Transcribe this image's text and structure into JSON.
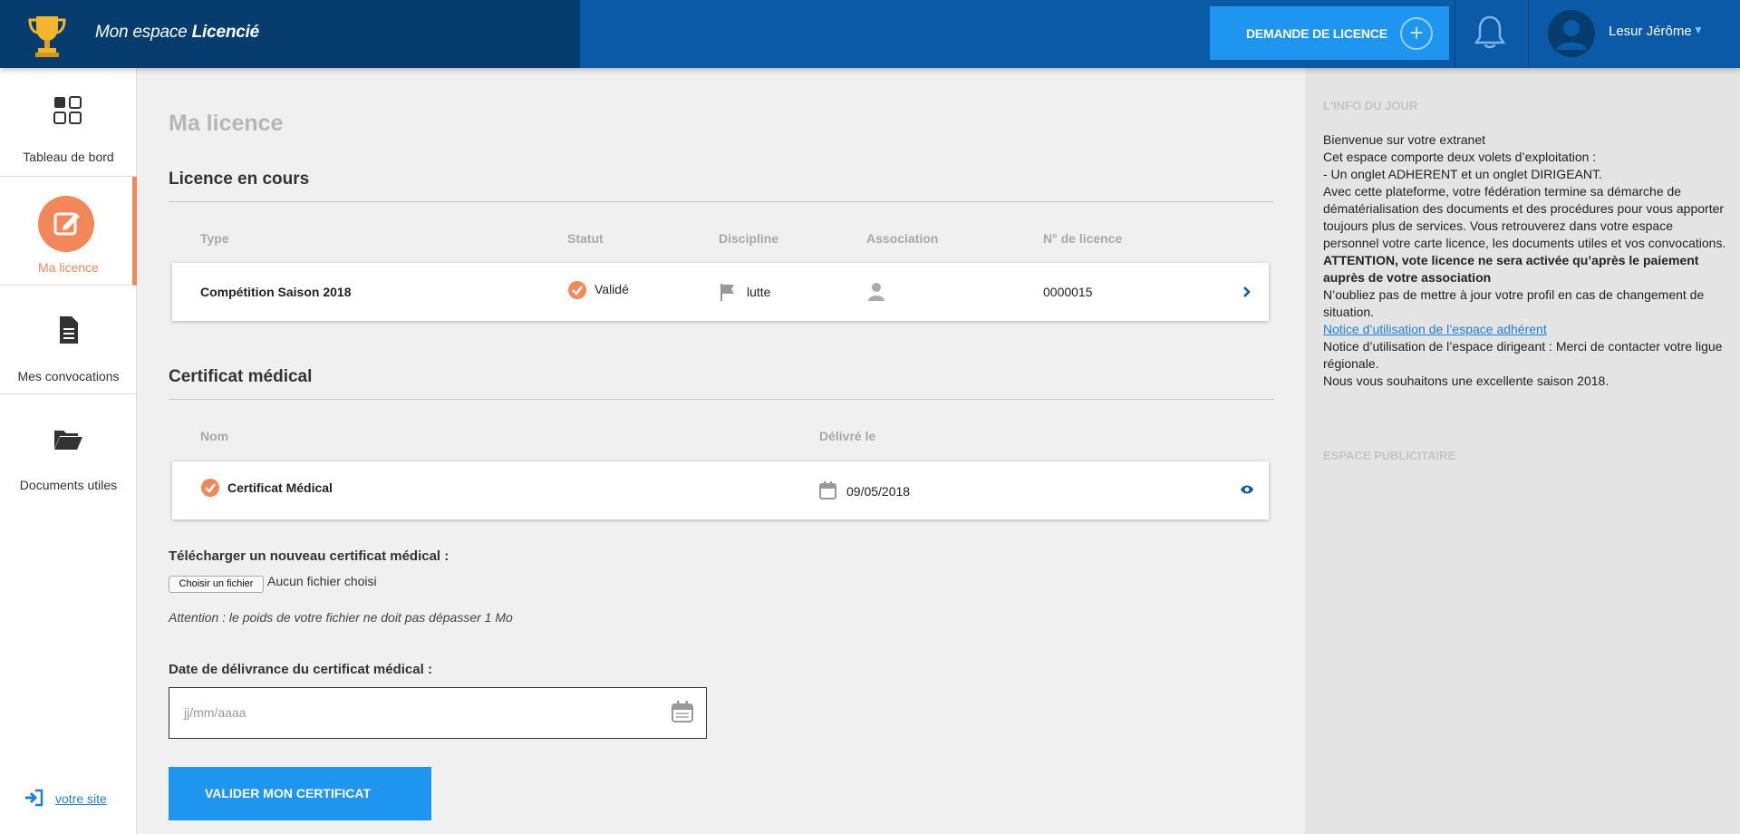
{
  "header": {
    "brand_prefix": "Mon espace",
    "brand_strong": "Licencié",
    "demande_label": "DEMANDE DE LICENCE",
    "user_name": "Lesur Jérôme",
    "colors": {
      "left": "#063c6e",
      "right": "#0b5aa8",
      "button": "#1e96f0"
    },
    "icons": {
      "logo": "trophy-icon",
      "add": "plus-circle-icon",
      "notifications": "bell-icon",
      "avatar": "user-avatar-icon",
      "menu": "chevron-down-icon"
    }
  },
  "sidebar": {
    "items": [
      {
        "label": "Tableau de bord",
        "icon": "dashboard-grid-icon",
        "active": false
      },
      {
        "label": "Ma licence",
        "icon": "edit-icon",
        "active": true
      },
      {
        "label": "Mes convocations",
        "icon": "document-icon",
        "active": false
      },
      {
        "label": "Documents utiles",
        "icon": "folder-open-icon",
        "active": false
      }
    ],
    "footer_link": "votre site",
    "accent": "#f2875a"
  },
  "main": {
    "page_title": "Ma licence",
    "licence": {
      "section_title": "Licence en cours",
      "columns": [
        "Type",
        "Statut",
        "Discipline",
        "Association",
        "N° de licence"
      ],
      "row": {
        "type": "Compétition Saison 2018",
        "statut": "Validé",
        "discipline": "lutte",
        "numero": "0000015"
      }
    },
    "certificat": {
      "section_title": "Certificat médical",
      "columns": [
        "Nom",
        "Délivré le"
      ],
      "row": {
        "nom": "Certificat Médical",
        "date": "09/05/2018"
      }
    },
    "upload": {
      "label": "Télécharger un nouveau certificat médical :",
      "file_button": "Choisir un fichier",
      "file_status": "Aucun fichier choisi",
      "warning": "Attention : le poids de votre fichier ne doit pas dépasser 1 Mo"
    },
    "date_field": {
      "label": "Date de délivrance du certificat médical :",
      "placeholder": "jj/mm/aaaa"
    },
    "submit_label": "VALIDER MON CERTIFICAT"
  },
  "right": {
    "info_title": "L'INFO DU JOUR",
    "lines": [
      "Bienvenue sur votre extranet",
      "Cet espace comporte deux volets d’exploitation :",
      "- Un onglet ADHERENT et un onglet DIRIGEANT.",
      "Avec cette plateforme, votre fédération termine sa démarche de dématérialisation des documents et des procédures pour vous apporter toujours plus de services. Vous retrouverez dans votre espace personnel votre carte licence, les documents utiles et vos convocations."
    ],
    "attention": "ATTENTION, vote licence ne sera activée qu’après le paiement auprès de votre association",
    "lines2": [
      "N’oubliez pas de mettre à jour votre profil en cas de changement de situation."
    ],
    "notice_link": "Notice d’utilisation de l’espace adhérent",
    "lines3": [
      "Notice d’utilisation de l’espace dirigeant : Merci de contacter votre ligue régionale.",
      "Nous vous souhaitons une excellente saison 2018."
    ],
    "pub_title": "ESPACE PUBLICITAIRE"
  }
}
